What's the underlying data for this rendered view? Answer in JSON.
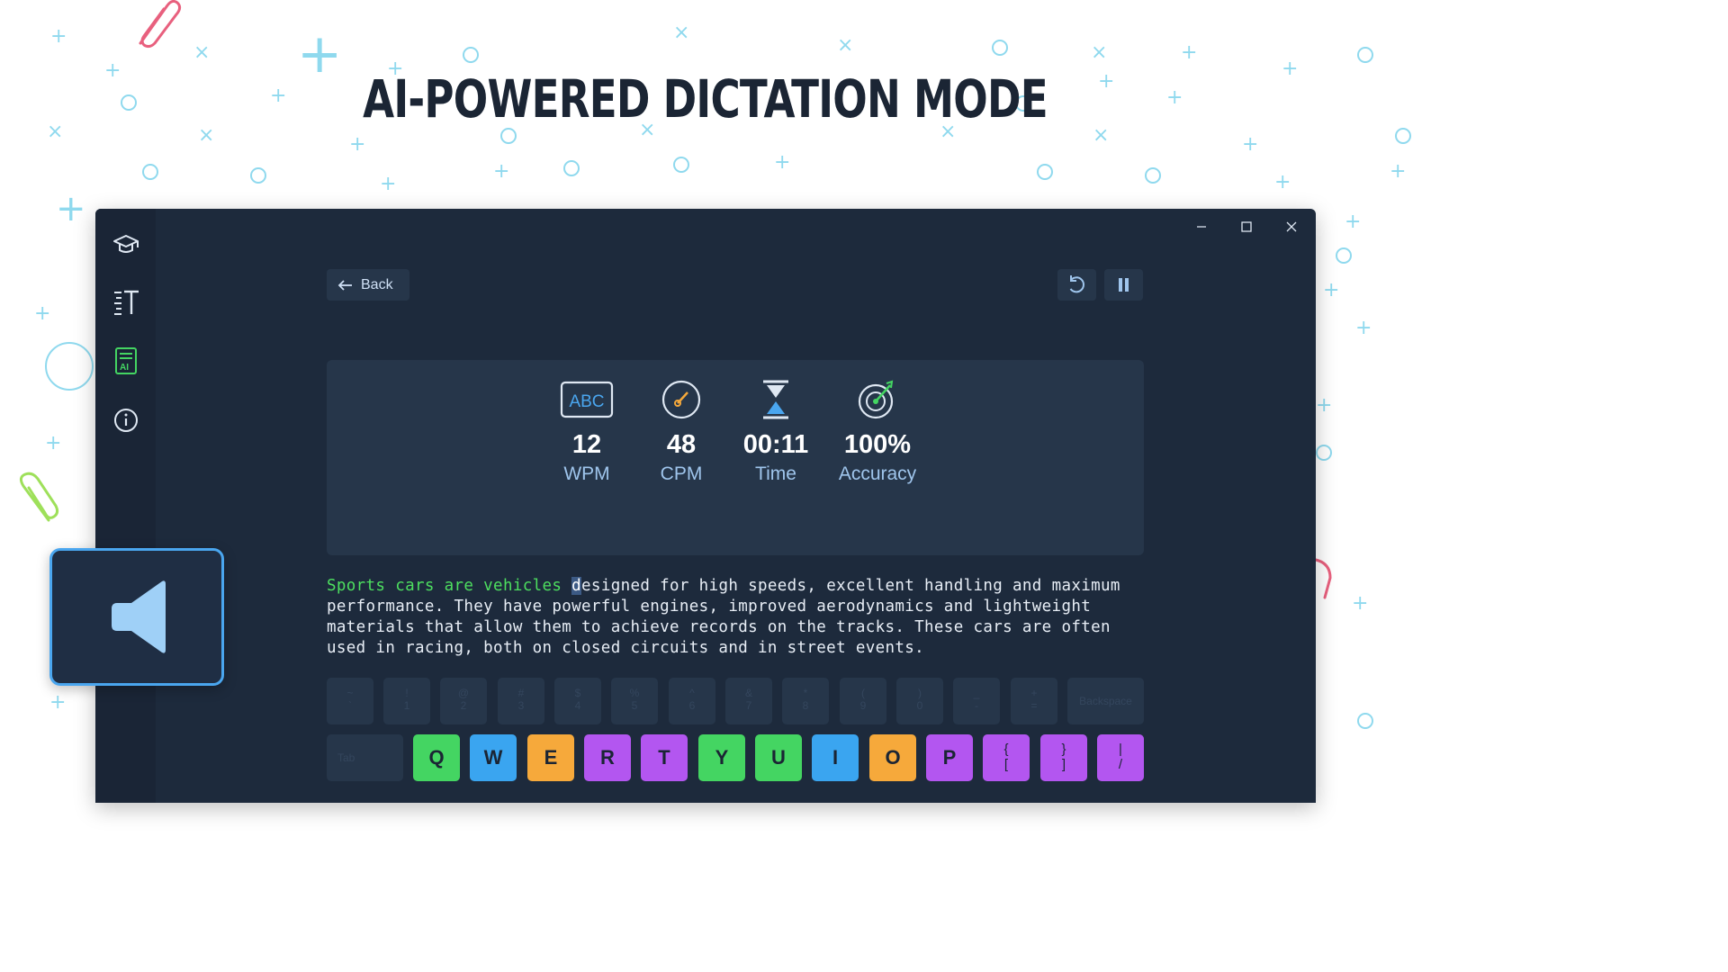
{
  "headline": "AI-POWERED DICTATION MODE",
  "toolbar": {
    "back_label": "Back"
  },
  "stats": [
    {
      "value": "12",
      "label": "WPM",
      "icon": "abc-icon",
      "icon_text": "ABC"
    },
    {
      "value": "48",
      "label": "CPM",
      "icon": "speedometer-icon"
    },
    {
      "value": "00:11",
      "label": "Time",
      "icon": "hourglass-icon"
    },
    {
      "value": "100%",
      "label": "Accuracy",
      "icon": "target-icon"
    }
  ],
  "passage": {
    "typed": "Sports cars are vehicles ",
    "current": "d",
    "rest_line1": "esigned for high speeds, excellent handling and maximum",
    "line2": "performance. They have powerful engines, improved aerodynamics and lightweight",
    "line3": "materials that allow them to achieve records on the tracks. These cars are often",
    "line4": "used in racing, both on closed circuits and in street events."
  },
  "keyboard": {
    "number_row": [
      {
        "top": "~",
        "bottom": "`"
      },
      {
        "top": "!",
        "bottom": "1"
      },
      {
        "top": "@",
        "bottom": "2"
      },
      {
        "top": "#",
        "bottom": "3"
      },
      {
        "top": "$",
        "bottom": "4"
      },
      {
        "top": "%",
        "bottom": "5"
      },
      {
        "top": "^",
        "bottom": "6"
      },
      {
        "top": "&",
        "bottom": "7"
      },
      {
        "top": "*",
        "bottom": "8"
      },
      {
        "top": "(",
        "bottom": "9"
      },
      {
        "top": ")",
        "bottom": "0"
      },
      {
        "top": "_",
        "bottom": "-"
      },
      {
        "top": "+",
        "bottom": "="
      }
    ],
    "backspace_label": "Backspace",
    "tab_label": "Tab",
    "letter_row": [
      {
        "label": "Q",
        "color": "#44d562"
      },
      {
        "label": "W",
        "color": "#3aa5f0"
      },
      {
        "label": "E",
        "color": "#f6a93b"
      },
      {
        "label": "R",
        "color": "#b356f0"
      },
      {
        "label": "T",
        "color": "#b356f0"
      },
      {
        "label": "Y",
        "color": "#44d562"
      },
      {
        "label": "U",
        "color": "#44d562"
      },
      {
        "label": "I",
        "color": "#3aa5f0"
      },
      {
        "label": "O",
        "color": "#f6a93b"
      },
      {
        "label": "P",
        "color": "#b356f0"
      }
    ],
    "bracket_keys": [
      {
        "top": "{",
        "bottom": "[",
        "color": "#b356f0"
      },
      {
        "top": "}",
        "bottom": "]",
        "color": "#b356f0"
      },
      {
        "top": "|",
        "bottom": "/",
        "color": "#b356f0"
      }
    ]
  },
  "colors": {
    "accent": "#4aa6ef",
    "typed_text": "#4ddf5f",
    "window_bg": "#1d2a3c",
    "panel_bg": "#26364a"
  }
}
